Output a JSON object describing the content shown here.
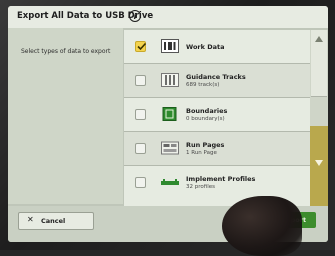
{
  "dialog": {
    "title": "Export All Data to USB Drive",
    "help_icon": "info-icon"
  },
  "left_pane": {
    "instruction": "Select types of data to export"
  },
  "items": [
    {
      "name": "Work Data",
      "detail": "",
      "checked": true,
      "icon": "work-data-icon"
    },
    {
      "name": "Guidance Tracks",
      "detail": "689 track(s)",
      "checked": false,
      "icon": "guidance-tracks-icon"
    },
    {
      "name": "Boundaries",
      "detail": "0 boundary(s)",
      "checked": false,
      "icon": "boundaries-icon"
    },
    {
      "name": "Run Pages",
      "detail": "1 Run Page",
      "checked": false,
      "icon": "run-pages-icon"
    },
    {
      "name": "Implement Profiles",
      "detail": "32 profiles",
      "checked": false,
      "icon": "implement-profiles-icon"
    }
  ],
  "footer": {
    "cancel_label": "Cancel",
    "export_label": "Export"
  },
  "colors": {
    "checked": "#f4d34e",
    "export_button": "#3c8c2c",
    "scroll_down": "#b9a84d"
  }
}
